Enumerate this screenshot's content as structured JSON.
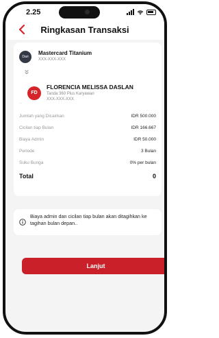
{
  "status_bar": {
    "time": "2.25"
  },
  "header": {
    "title": "Ringkasan Transaksi"
  },
  "source": {
    "avatar_label": "Dari",
    "name": "Mastercard Titanium",
    "number": "XXX-XXX-XXX"
  },
  "destination": {
    "initials": "FD",
    "name": "FLORENCIA MELISSA DASLAN",
    "subtitle": "Tanda 360 Plus Karyawan",
    "number": "XXX-XXX-XXX"
  },
  "details": [
    {
      "label": "Jumlah yang Dicairkan",
      "value": "IDR 500.000"
    },
    {
      "label": "Cicilan tiap Bulan",
      "value": "IDR 166.667"
    },
    {
      "label": "Biaya Admin",
      "value": "IDR 50.000"
    },
    {
      "label": "Periode",
      "value": "3 Bulan"
    },
    {
      "label": "Suku Bunga",
      "value": "0% per bulan"
    }
  ],
  "total": {
    "label": "Total",
    "value": "0"
  },
  "info": {
    "text": "Biaya admin dan cicilan tiap bulan akan ditagihkan ke tagihan bulan depan.."
  },
  "actions": {
    "continue_label": "Lanjut"
  },
  "colors": {
    "brand_red": "#d6252a",
    "button_red": "#c9202a"
  },
  "icons": [
    "back-arrow-icon",
    "chevron-down-icon",
    "info-icon",
    "signal-icon",
    "wifi-icon",
    "battery-icon"
  ]
}
